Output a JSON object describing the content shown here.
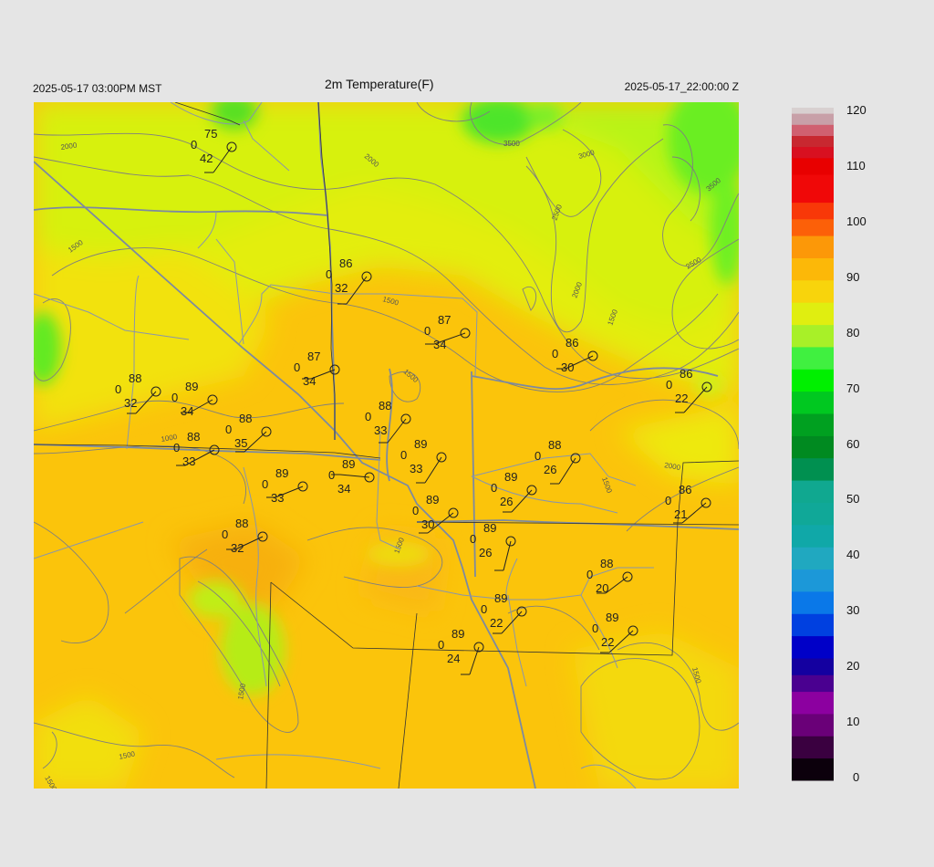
{
  "header": {
    "local_time": "2025-05-17 03:00PM MST",
    "title": "2m Temperature(F)",
    "utc_time": "2025-05-17_22:00:00 Z"
  },
  "colorbar": {
    "ticks": [
      "120",
      "110",
      "100",
      "90",
      "80",
      "70",
      "60",
      "50",
      "40",
      "30",
      "20",
      "10",
      "0"
    ]
  },
  "contour_labels": [
    "2000",
    "2000",
    "1500",
    "1500",
    "1500",
    "1000",
    "1500",
    "2000",
    "2500",
    "3000",
    "3500",
    "3500",
    "2500",
    "2000",
    "1500",
    "1500",
    "1500",
    "1500",
    "1500",
    "1500"
  ],
  "stations": [
    {
      "temp": "75",
      "zero": "0",
      "dew": "42"
    },
    {
      "temp": "86",
      "zero": "0",
      "dew": "32"
    },
    {
      "temp": "87",
      "zero": "0",
      "dew": "34"
    },
    {
      "temp": "87",
      "zero": "0",
      "dew": "34"
    },
    {
      "temp": "86",
      "zero": "0",
      "dew": "30"
    },
    {
      "temp": "86",
      "zero": "0",
      "dew": "22"
    },
    {
      "temp": "88",
      "zero": "0",
      "dew": "32"
    },
    {
      "temp": "89",
      "zero": "0",
      "dew": "34"
    },
    {
      "temp": "88",
      "zero": "0",
      "dew": "33"
    },
    {
      "temp": "88",
      "zero": "0",
      "dew": "35"
    },
    {
      "temp": "88",
      "zero": "0",
      "dew": "33"
    },
    {
      "temp": "89",
      "zero": "0",
      "dew": "33"
    },
    {
      "temp": "88",
      "zero": "0",
      "dew": "26"
    },
    {
      "temp": "89",
      "zero": "0",
      "dew": "34"
    },
    {
      "temp": "89",
      "zero": "0",
      "dew": "33"
    },
    {
      "temp": "89",
      "zero": "0",
      "dew": "26"
    },
    {
      "temp": "86",
      "zero": "0",
      "dew": "21"
    },
    {
      "temp": "88",
      "zero": "0",
      "dew": "32"
    },
    {
      "temp": "89",
      "zero": "0",
      "dew": "30"
    },
    {
      "temp": "89",
      "zero": "0",
      "dew": "26"
    },
    {
      "temp": "88",
      "zero": "0",
      "dew": "20"
    },
    {
      "temp": "89",
      "zero": "0",
      "dew": "22"
    },
    {
      "temp": "89",
      "zero": "0",
      "dew": "22"
    },
    {
      "temp": "89",
      "zero": "0",
      "dew": "24"
    }
  ]
}
